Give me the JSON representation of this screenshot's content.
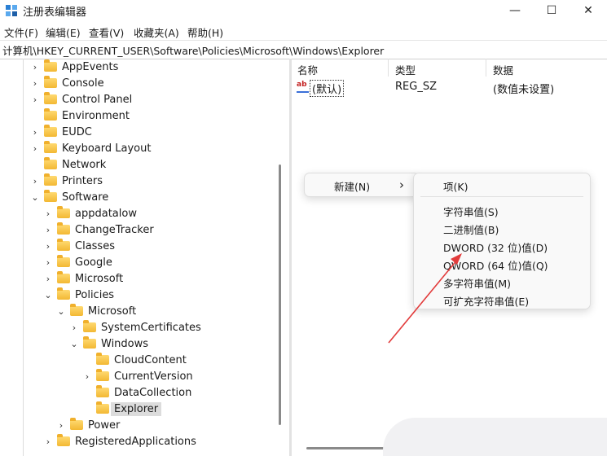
{
  "window": {
    "title": "注册表编辑器",
    "controls": {
      "minimize": "—",
      "maximize": "☐",
      "close": "✕"
    }
  },
  "menu": [
    "文件(F)",
    "编辑(E)",
    "查看(V)",
    "收藏夹(A)",
    "帮助(H)"
  ],
  "address": "计算机\\HKEY_CURRENT_USER\\Software\\Policies\\Microsoft\\Windows\\Explorer",
  "tree": [
    {
      "label": "AppEvents",
      "chevron": "›"
    },
    {
      "label": "Console",
      "chevron": "›"
    },
    {
      "label": "Control Panel",
      "chevron": "›"
    },
    {
      "label": "Environment",
      "chevron": ""
    },
    {
      "label": "EUDC",
      "chevron": "›"
    },
    {
      "label": "Keyboard Layout",
      "chevron": "›"
    },
    {
      "label": "Network",
      "chevron": ""
    },
    {
      "label": "Printers",
      "chevron": "›"
    },
    {
      "label": "Software",
      "chevron": "⌄"
    },
    {
      "label": "appdatalow",
      "chevron": "›"
    },
    {
      "label": "ChangeTracker",
      "chevron": "›"
    },
    {
      "label": "Classes",
      "chevron": "›"
    },
    {
      "label": "Google",
      "chevron": "›"
    },
    {
      "label": "Microsoft",
      "chevron": "›"
    },
    {
      "label": "Policies",
      "chevron": "⌄"
    },
    {
      "label": "Microsoft",
      "chevron": "⌄"
    },
    {
      "label": "SystemCertificates",
      "chevron": "›"
    },
    {
      "label": "Windows",
      "chevron": "⌄"
    },
    {
      "label": "CloudContent",
      "chevron": ""
    },
    {
      "label": "CurrentVersion",
      "chevron": "›"
    },
    {
      "label": "DataCollection",
      "chevron": ""
    },
    {
      "label": "Explorer",
      "chevron": ""
    },
    {
      "label": "Power",
      "chevron": "›"
    },
    {
      "label": "RegisteredApplications",
      "chevron": "›"
    }
  ],
  "columns": {
    "name": "名称",
    "type": "类型",
    "data": "数据"
  },
  "value_row": {
    "icon": "ab",
    "name": "(默认)",
    "type": "REG_SZ",
    "data": "(数值未设置)"
  },
  "context_menu": {
    "new_label": "新建(N)",
    "new_arrow": "›",
    "submenu": {
      "key": "项(K)",
      "items": [
        "字符串值(S)",
        "二进制值(B)",
        "DWORD (32 位)值(D)",
        "QWORD (64 位)值(Q)",
        "多字符串值(M)",
        "可扩充字符串值(E)"
      ]
    }
  },
  "colors": {
    "annotation_arrow": "#e23b3b",
    "folder": "#f3b833",
    "selection": "#dcdcdc"
  }
}
